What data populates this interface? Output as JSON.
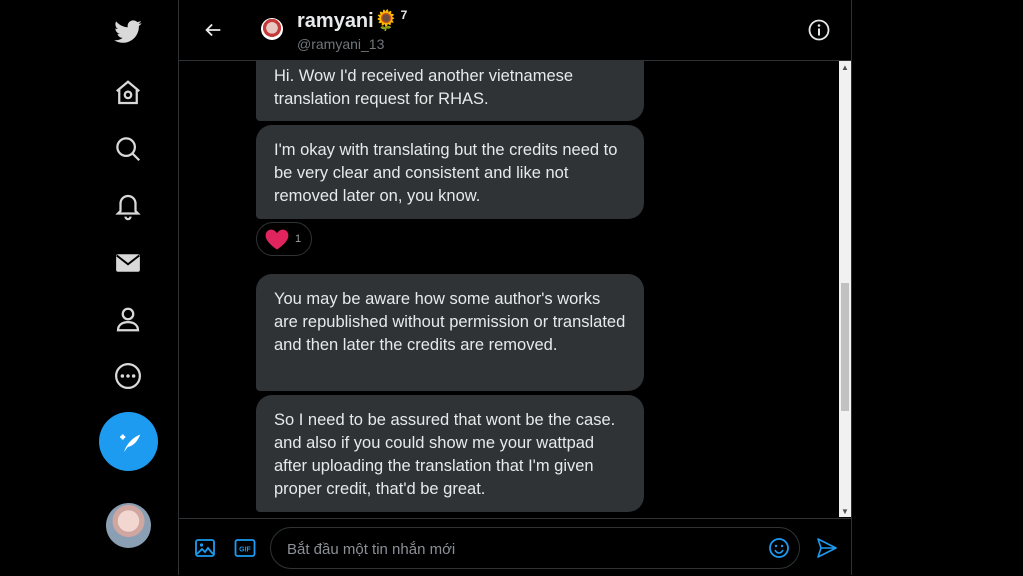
{
  "colors": {
    "accent": "#1d9bf0",
    "bubble": "#2f3336",
    "heart": "#e0245e"
  },
  "nav": {
    "items": [
      {
        "name": "twitter-logo-icon"
      },
      {
        "name": "home-icon"
      },
      {
        "name": "explore-search-icon"
      },
      {
        "name": "notifications-bell-icon"
      },
      {
        "name": "messages-mail-icon"
      },
      {
        "name": "profile-person-icon"
      },
      {
        "name": "more-icon"
      }
    ],
    "compose_icon": "compose-tweet-icon"
  },
  "header": {
    "name": "ramyani",
    "emoji": "🌻",
    "superscript": "7",
    "handle": "@ramyani_13"
  },
  "messages": [
    {
      "text": "Hi. Wow I'd received another vietnamese translation request for RHAS."
    },
    {
      "text": "I'm okay with translating but the credits need to be very clear and consistent and like not removed later on, you know."
    },
    {
      "text": "You may be aware how some author's works are republished without permission or translated and then later the credits are removed."
    },
    {
      "text": "So I need to be assured that wont be the case. and also if you could show me your wattpad after uploading the translation that I'm given proper credit, that'd be great."
    }
  ],
  "reaction": {
    "icon": "heart-icon",
    "count": "1"
  },
  "composer": {
    "placeholder": "Bắt đầu một tin nhắn mới",
    "gif_label": "GIF"
  }
}
